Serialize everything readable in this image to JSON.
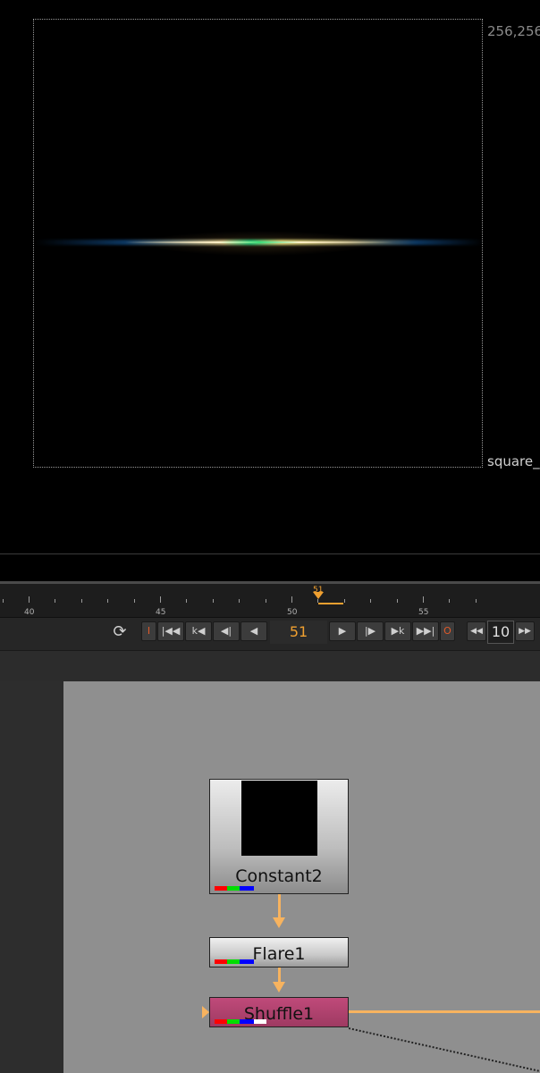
{
  "viewer": {
    "coord_label": "256,256",
    "format_label": "square_"
  },
  "timeline": {
    "ticks": [
      "40",
      "45",
      "50",
      "55"
    ],
    "current_frame_marker": "51"
  },
  "controls": {
    "in_label": "I",
    "out_label": "O",
    "frame": "51",
    "increment": "10",
    "buttons": [
      "first-frame",
      "prev-keyframe",
      "prev-increment",
      "step-back",
      "play-backward",
      "play-forward",
      "step-forward",
      "next-increment",
      "last-frame"
    ]
  },
  "nodes": {
    "constant": {
      "label": "Constant2"
    },
    "flare": {
      "label": "Flare1"
    },
    "shuffle": {
      "label": "Shuffle1"
    }
  },
  "colors": {
    "pipe": "#f7b35f",
    "shuffle_node": "#9e3a62",
    "frame_accent": "#f0a030",
    "in_out": "#e05a2a"
  }
}
